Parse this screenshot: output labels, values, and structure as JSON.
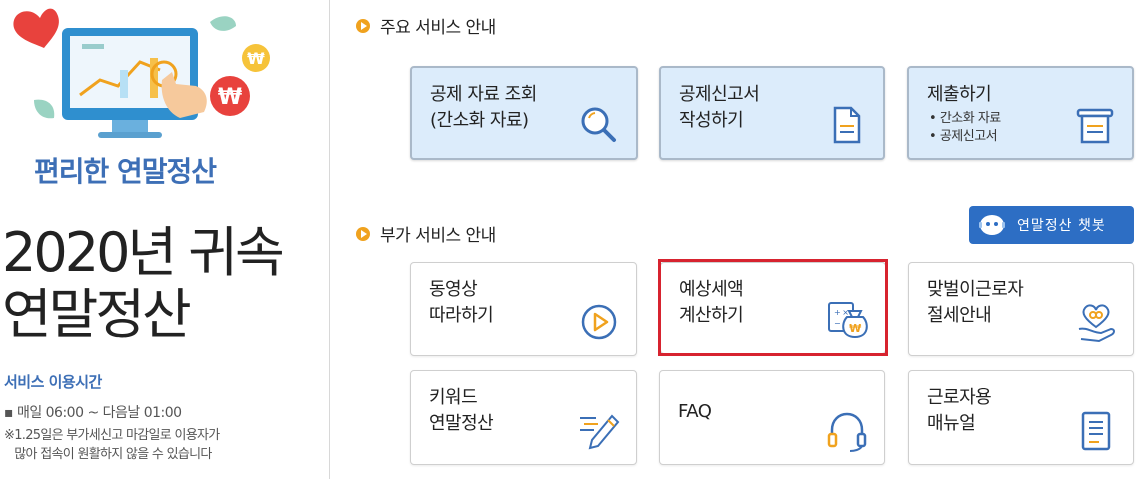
{
  "left_panel": {
    "subtitle": "편리한 연말정산",
    "title_line1": "2020년 귀속",
    "title_line2": "연말정산",
    "hours_label": "서비스 이용시간",
    "hours_time": "▪ 매일 06:00 ~ 다음날 01:00",
    "hours_note": "※1.25일은 부가세신고 마감일로 이용자가\n   많아 접속이 원활하지 않을 수 있습니다"
  },
  "main_services": {
    "heading": "주요 서비스 안내",
    "cards": [
      {
        "label": "공제 자료 조회\n(간소화 자료)",
        "icon": "magnifier-icon"
      },
      {
        "label": "공제신고서\n작성하기",
        "icon": "document-icon"
      },
      {
        "label": "제출하기",
        "icon": "submit-tray-icon",
        "subs": [
          "간소화 자료",
          "공제신고서"
        ]
      }
    ]
  },
  "extra_services": {
    "heading": "부가 서비스 안내",
    "chatbot_label": "연말정산 챗봇",
    "cards": [
      {
        "label": "동영상\n따라하기",
        "icon": "play-icon"
      },
      {
        "label": "예상세액\n계산하기",
        "icon": "calculator-moneybag-icon"
      },
      {
        "label": "맞벌이근로자\n절세안내",
        "icon": "heart-hand-icon"
      },
      {
        "label": "키워드\n연말정산",
        "icon": "pencil-icon"
      },
      {
        "label": "FAQ",
        "icon": "headset-icon"
      },
      {
        "label": "근로자용\n매뉴얼",
        "icon": "manual-icon"
      }
    ]
  },
  "colors": {
    "accent": "#3d6fb6",
    "highlight": "#d7232f",
    "chatbot": "#2d6ec4",
    "bullet": "#f0a21e"
  }
}
